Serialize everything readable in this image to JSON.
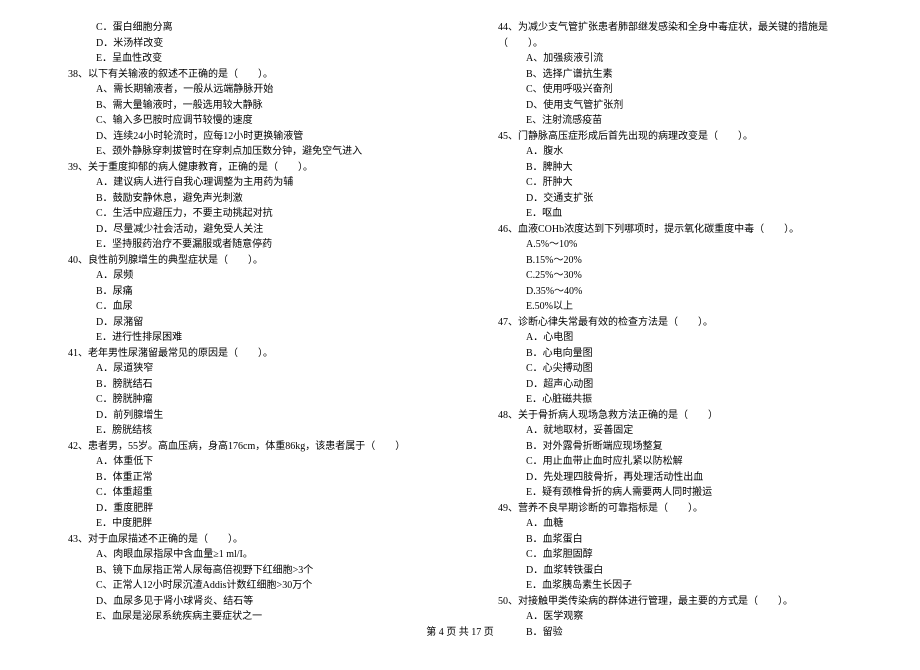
{
  "left": {
    "q37": {
      "C": "C．蛋白细胞分离",
      "D": "D．米汤样改变",
      "E": "E．呈血性改变"
    },
    "q38": {
      "stem": "38、以下有关输液的叙述不正确的是（　　）。",
      "A": "A、需长期输液者，一般从远端静脉开始",
      "B": "B、需大量输液时，一般选用较大静脉",
      "C": "C、输入多巴胺时应调节较慢的速度",
      "D": "D、连续24小时轮流时，应每12小时更换输液管",
      "E": "E、颈外静脉穿刺拔管时在穿刺点加压数分钟，避免空气进入"
    },
    "q39": {
      "stem": "39、关于重度抑郁的病人健康教育，正确的是（　　）。",
      "A": "A．建议病人进行自我心理调整为主用药为辅",
      "B": "B．鼓励安静休息，避免声光刺激",
      "C": "C．生活中应避压力，不要主动挑起对抗",
      "D": "D．尽量减少社会活动，避免受人关注",
      "E": "E．坚持服药治疗不要漏服或者随意停药"
    },
    "q40": {
      "stem": "40、良性前列腺增生的典型症状是（　　）。",
      "A": "A．尿频",
      "B": "B．尿痛",
      "C": "C．血尿",
      "D": "D．尿潴留",
      "E": "E．进行性排尿困难"
    },
    "q41": {
      "stem": "41、老年男性尿潴留最常见的原因是（　　）。",
      "A": "A．尿道狭窄",
      "B": "B．膀胱结石",
      "C": "C．膀胱肿瘤",
      "D": "D．前列腺增生",
      "E": "E．膀胱结核"
    },
    "q42": {
      "stem": "42、患者男，55岁。高血压病，身高176cm，体重86kg，该患者属于（　　）",
      "A": "A．体重低下",
      "B": "B．体重正常",
      "C": "C．体重超重",
      "D": "D．重度肥胖",
      "E": "E．中度肥胖"
    },
    "q43": {
      "stem": "43、对于血尿描述不正确的是（　　）。",
      "A": "A、肉眼血尿指尿中含血量≥1 ml/I。",
      "B": "B、镜下血尿指正常人尿每高倍视野下红细胞>3个",
      "C": "C、正常人12小时尿沉渣Addis计数红细胞>30万个",
      "D": "D、血尿多见于肾小球肾炎、结石等",
      "E": "E、血尿是泌尿系统疾病主要症状之一"
    }
  },
  "right": {
    "q44": {
      "stem": "44、为减少支气管扩张患者肺部继发感染和全身中毒症状，最关键的措施是（　　）。",
      "A": "A、加强痰液引流",
      "B": "B、选择广谱抗生素",
      "C": "C、使用呼吸兴奋剂",
      "D": "D、使用支气管扩张剂",
      "E": "E、注射流感疫苗"
    },
    "q45": {
      "stem": "45、门静脉高压症形成后首先出现的病理改变是（　　）。",
      "A": "A．腹水",
      "B": "B．脾肿大",
      "C": "C．肝肿大",
      "D": "D．交通支扩张",
      "E": "E．呕血"
    },
    "q46": {
      "stem": "46、血液COHb浓度达到下列哪项时，提示氧化碳重度中毒（　　）。",
      "A": "A.5%～10%",
      "B": "B.15%～20%",
      "C": "C.25%～30%",
      "D": "D.35%～40%",
      "E": "E.50%以上"
    },
    "q47": {
      "stem": "47、诊断心律失常最有效的检查方法是（　　）。",
      "A": "A．心电图",
      "B": "B．心电向量图",
      "C": "C．心尖搏动图",
      "D": "D．超声心动图",
      "E": "E．心脏磁共振"
    },
    "q48": {
      "stem": "48、关于骨折病人现场急救方法正确的是（　　）",
      "A": "A．就地取材，妥善固定",
      "B": "B．对外露骨折断端应现场整复",
      "C": "C．用止血带止血时应扎紧以防松解",
      "D": "D．先处理四肢骨折，再处理活动性出血",
      "E": "E．疑有颈椎骨折的病人需要两人同时搬运"
    },
    "q49": {
      "stem": "49、营养不良早期诊断的可靠指标是（　　）。",
      "A": "A．血糖",
      "B": "B．血浆蛋白",
      "C": "C．血浆胆固醇",
      "D": "D．血浆转铁蛋白",
      "E": "E．血浆胰岛素生长因子"
    },
    "q50": {
      "stem": "50、对接触甲类传染病的群体进行管理，最主要的方式是（　　）。",
      "A": "A．医学观察",
      "B": "B．留验"
    }
  },
  "footer": "第 4 页 共 17 页"
}
